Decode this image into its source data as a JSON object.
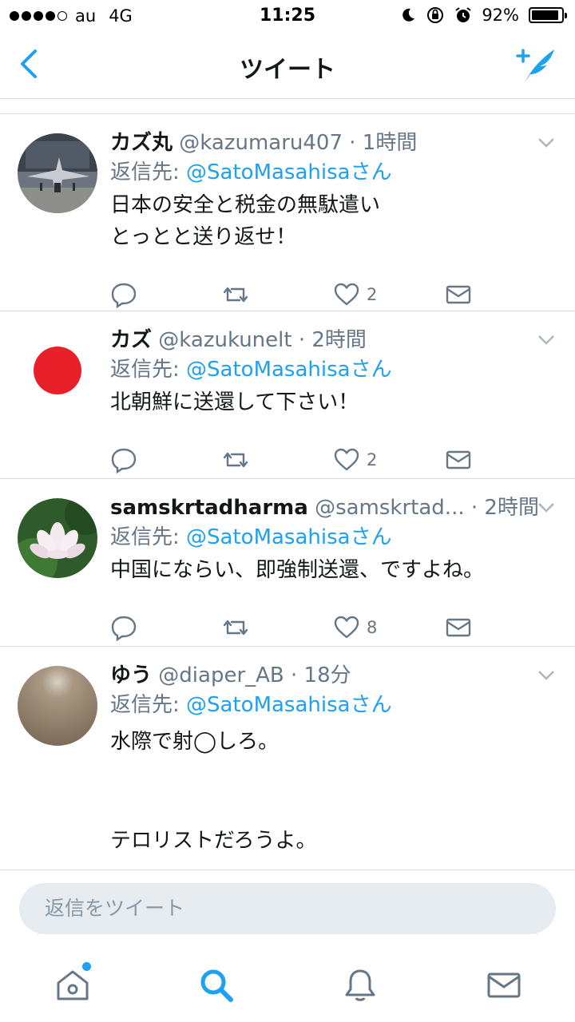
{
  "status_bar": {
    "carrier": "au",
    "network": "4G",
    "time": "11:25",
    "battery": "92%",
    "battery_level": 0.92,
    "signal_bars": 4
  },
  "nav": {
    "title": "ツイート",
    "back_icon": "chevron-left-icon",
    "compose_icon": "compose-tweet-icon"
  },
  "colors": {
    "accent": "#1da1f2",
    "secondary_text": "#657786",
    "divider": "#d6dadd"
  },
  "tweets": [
    {
      "name": "カズ丸",
      "handle": "@kazumaru407",
      "time": "· 1時間",
      "reply_prefix": "返信先: ",
      "mention": "@SatoMasahisaさん",
      "text": "日本の安全と税金の無駄遣い\nとっとと送り返せ！",
      "likes": "2",
      "avatar": "fighter-jet-avatar"
    },
    {
      "name": "カズ",
      "handle": "@kazukunelt",
      "time": "· 2時間",
      "reply_prefix": "返信先: ",
      "mention": "@SatoMasahisaさん",
      "text": "北朝鮮に送還して下さい！",
      "likes": "2",
      "avatar": "japan-flag-avatar"
    },
    {
      "name": "samskrtadharma",
      "handle": "@samskrtad...",
      "time": "· 2時間",
      "reply_prefix": "返信先: ",
      "mention": "@SatoMasahisaさん",
      "text": "中国にならい、即強制送還、ですよね。",
      "likes": "8",
      "avatar": "lotus-flower-avatar"
    },
    {
      "name": "ゆう",
      "handle": "@diaper_AB",
      "time": "· 18分",
      "reply_prefix": "返信先: ",
      "mention": "@SatoMasahisaさん",
      "text": "水際で射◯しろ。\n\nテロリストだろうよ。\n\n男八人で冬の日本海を越えてくるって普通",
      "likes": "",
      "avatar": "plain-brown-avatar"
    }
  ],
  "reply_bar": {
    "placeholder": "返信をツイート"
  },
  "tab_bar": {
    "items": [
      "home-icon",
      "search-icon",
      "notifications-icon",
      "messages-icon"
    ],
    "active": "search-icon"
  }
}
